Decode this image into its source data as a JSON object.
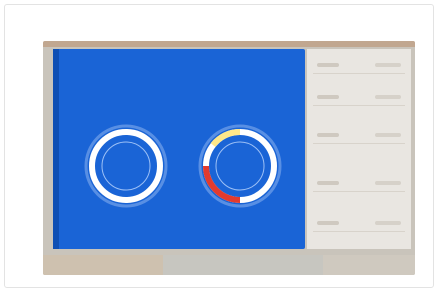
{
  "dashboard": {
    "title": "",
    "subtitle": "",
    "corner_label": "",
    "gauges": [
      {
        "label": "",
        "value": "",
        "color": "#ffffff"
      },
      {
        "label": "",
        "value": "",
        "colors": [
          "#ffffff",
          "#e23b2f",
          "#ffe88a"
        ]
      }
    ],
    "footer": [
      "",
      ""
    ]
  },
  "colors": {
    "panel": "#1a64d6",
    "frame": "#c9c4bb",
    "side": "#e9e6e1"
  }
}
